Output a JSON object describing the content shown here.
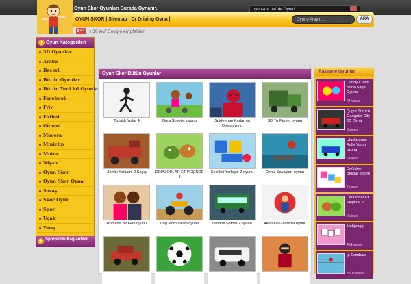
{
  "header": {
    "tagline": "Oyun Skor Oyunları Burada Oynanır.",
    "flash_message": "oyunskor.net' de Oyna!",
    "nav_links": [
      "OYUN SKOR",
      "Sitemap",
      "Dr Driving Oyna"
    ],
    "nav_separator": " | ",
    "search_placeholder": "Oyunu Arayın...",
    "search_button": "ARA",
    "gplus_label": "g+1",
    "plusone_count": "+30",
    "gplus_text": "Auf Google empfehlen"
  },
  "sidebar": {
    "title": "Oyun Kategorileri",
    "items": [
      "3D Oyunlar",
      "Araba",
      "Beceri",
      "Bütün Oyunlar",
      "Bütün Yeni Yıl Oyunları",
      "Facebook",
      "Friv",
      "Futbol",
      "Güncel",
      "Macera",
      "Miniclip",
      "Motor",
      "Nişan",
      "Oyun Skor",
      "Oyun Skor Oyna",
      "Savaş",
      "Skor Oyun",
      "Spor",
      "Uçak",
      "Yarış"
    ],
    "sponsor_title": "Sponsorlu Bağlantılar"
  },
  "main": {
    "title": "Oyun Skor Bütün Oyunlar",
    "games": [
      {
        "title": "Tuzaklı Yollar 4",
        "icon": "stickman-thumbnail"
      },
      {
        "title": "Dora Scooter oyunu",
        "icon": "dora-thumbnail"
      },
      {
        "title": "Spiderman Kurtarma Operasyonu",
        "icon": "spiderman-thumbnail"
      },
      {
        "title": "3D Tır Parket oyunu",
        "icon": "truck-thumbnail"
      },
      {
        "title": "Zombi Katliamı 2 Kaçış",
        "icon": "zombie-truck-thumbnail"
      },
      {
        "title": "DİNAZORLAR ET PEŞİNDE 3",
        "icon": "dinosaur-thumbnail"
      },
      {
        "title": "Şekilleri Yerleştir 2 oyunu",
        "icon": "shapes-thumbnail"
      },
      {
        "title": "Deniz Savaşları oyunu",
        "icon": "sea-battle-thumbnail"
      },
      {
        "title": "Romada Bir Gün oyunu",
        "icon": "couple-thumbnail"
      },
      {
        "title": "Dağ Motorsikleti oyunu",
        "icon": "motorbike-thumbnail"
      },
      {
        "title": "Otobüs Şöförü 2 oyunu",
        "icon": "bus-thumbnail"
      },
      {
        "title": "Akrobasi Gösterisi oyunu",
        "icon": "acrobat-thumbnail"
      },
      {
        "title": "",
        "icon": "racecar-thumbnail"
      },
      {
        "title": "",
        "icon": "soccer-thumbnail"
      },
      {
        "title": "",
        "icon": "minivan-thumbnail"
      },
      {
        "title": "",
        "icon": "ninja-thumbnail"
      }
    ]
  },
  "random": {
    "title": "Rastgele Oyunlar",
    "items": [
      {
        "title": "Candy Crush Soda Saga Oyunu",
        "views": "24 views"
      },
      {
        "title": "Çılgın Sürücü Gangster City 3D Oyna",
        "views": "0 views"
      },
      {
        "title": "Uluslararası Rally Yarışı oyunu",
        "views": "6 views"
      },
      {
        "title": "Değişken Bloklar oyunu",
        "views": "1 views"
      },
      {
        "title": "Dinazorlar Et Peşinde 2",
        "views": "0 views"
      },
      {
        "title": "Mahjongg",
        "views": "434 views"
      },
      {
        "title": "İp Cambazı",
        "views": "3.910 views"
      }
    ]
  },
  "colors": {
    "accent_purple": "#7b2670",
    "accent_yellow": "#f7c61c",
    "topbar": "#3a3a3a"
  }
}
